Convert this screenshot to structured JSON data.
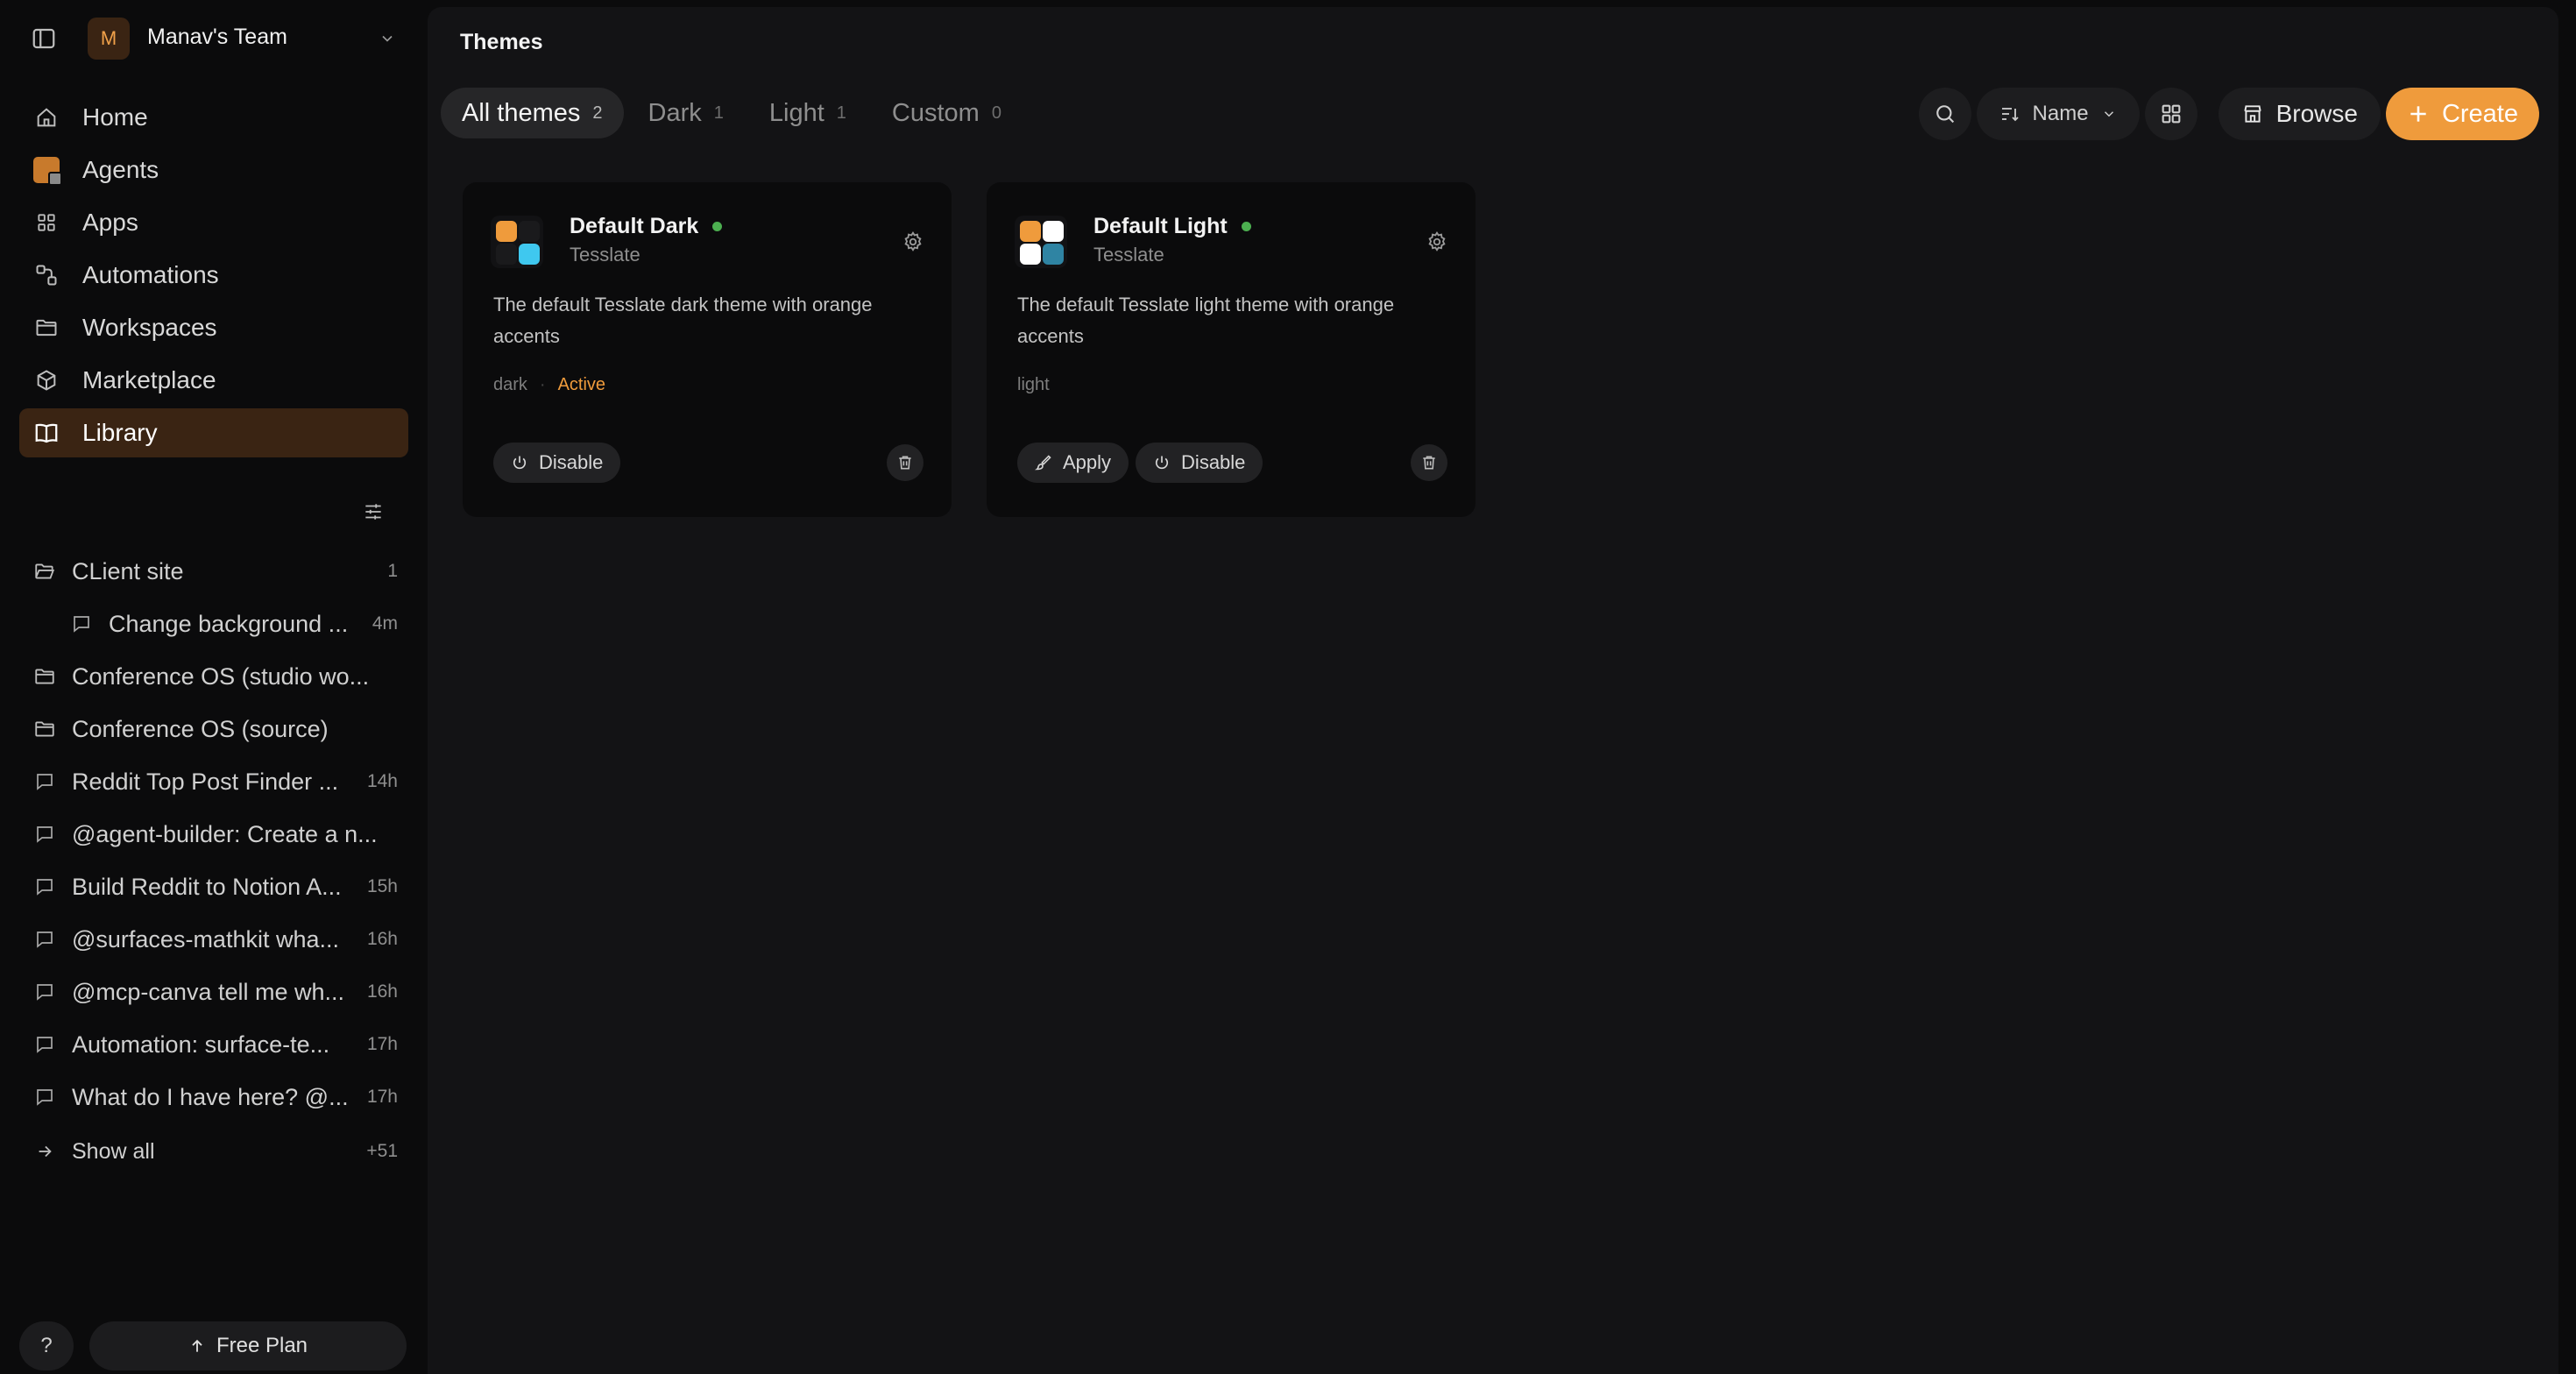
{
  "sidebar": {
    "team": {
      "avatar_letter": "M",
      "name": "Manav's Team"
    },
    "nav": [
      {
        "label": "Home",
        "icon": "home-icon"
      },
      {
        "label": "Agents",
        "icon": "agents-icon"
      },
      {
        "label": "Apps",
        "icon": "apps-icon"
      },
      {
        "label": "Automations",
        "icon": "automations-icon"
      },
      {
        "label": "Workspaces",
        "icon": "folder-icon"
      },
      {
        "label": "Marketplace",
        "icon": "cube-icon"
      },
      {
        "label": "Library",
        "icon": "book-icon",
        "active": true
      }
    ],
    "recents": [
      {
        "label": "CLient site",
        "meta": "1",
        "icon": "folder-open-icon"
      },
      {
        "label": "Change background ...",
        "meta": "4m",
        "icon": "chat-icon",
        "child": true
      },
      {
        "label": "Conference OS (studio wo...",
        "meta": "",
        "icon": "folder-icon"
      },
      {
        "label": "Conference OS (source)",
        "meta": "",
        "icon": "folder-icon"
      },
      {
        "label": "Reddit Top Post Finder ...",
        "meta": "14h",
        "icon": "chat-icon"
      },
      {
        "label": "@agent-builder: Create a n...",
        "meta": "",
        "icon": "chat-icon"
      },
      {
        "label": "Build Reddit to Notion A...",
        "meta": "15h",
        "icon": "chat-icon"
      },
      {
        "label": "@surfaces-mathkit wha...",
        "meta": "16h",
        "icon": "chat-icon"
      },
      {
        "label": "@mcp-canva tell me wh...",
        "meta": "16h",
        "icon": "chat-icon"
      },
      {
        "label": "Automation: surface-te...",
        "meta": "17h",
        "icon": "chat-icon"
      },
      {
        "label": "What do I have here? @...",
        "meta": "17h",
        "icon": "chat-icon"
      }
    ],
    "show_all": {
      "label": "Show all",
      "meta": "+51"
    },
    "help_label": "?",
    "plan_label": "Free Plan"
  },
  "main": {
    "title": "Themes",
    "tabs": [
      {
        "label": "All themes",
        "count": "2",
        "active": true
      },
      {
        "label": "Dark",
        "count": "1"
      },
      {
        "label": "Light",
        "count": "1"
      },
      {
        "label": "Custom",
        "count": "0"
      }
    ],
    "toolbar": {
      "sort_label": "Name",
      "browse_label": "Browse",
      "create_label": "Create"
    },
    "cards": [
      {
        "name": "Default Dark",
        "author": "Tesslate",
        "description": "The default Tesslate dark theme with orange accents",
        "tag": "dark",
        "status": "Active",
        "actions": [
          "Disable"
        ]
      },
      {
        "name": "Default Light",
        "author": "Tesslate",
        "description": "The default Tesslate light theme with orange accents",
        "tag": "light",
        "status": "",
        "actions": [
          "Apply",
          "Disable"
        ]
      }
    ]
  },
  "colors": {
    "accent": "#ef9b3c",
    "active_nav_bg": "#3a2413",
    "status_green": "#4caf50",
    "background": "#0b0b0c",
    "panel": "#131315"
  }
}
